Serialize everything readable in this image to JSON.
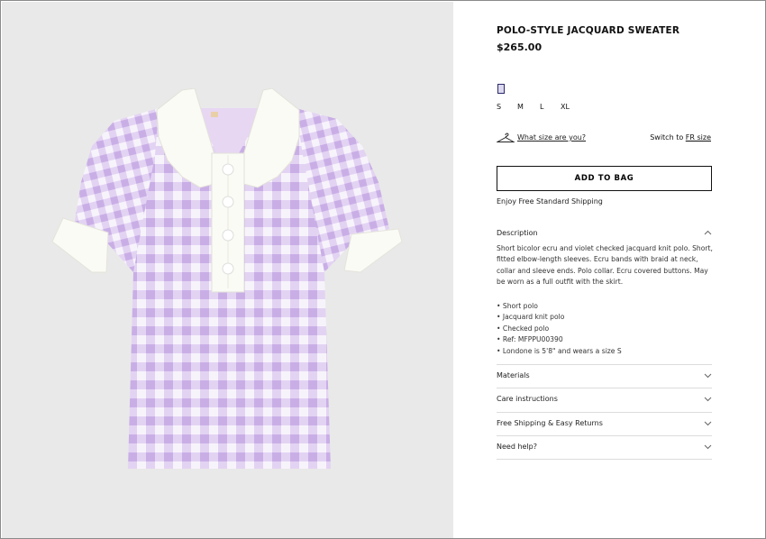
{
  "product": {
    "title": "POLO-STYLE JACQUARD SWEATER",
    "price": "$265.00",
    "sizes": [
      "S",
      "M",
      "L",
      "XL"
    ],
    "size_help": "What size are you?",
    "switch_prefix": "Switch to",
    "switch_link": "FR size",
    "add_to_bag": "ADD TO BAG",
    "shipping_note": "Enjoy Free Standard Shipping"
  },
  "accordion": {
    "description": {
      "label": "Description",
      "text": "Short bicolor ecru and violet checked jacquard knit polo. Short, fitted elbow-length sleeves. Ecru bands with braid at neck, collar and sleeve ends. Polo collar. Ecru covered buttons. May be worn as a full outfit with the skirt.",
      "bullets": [
        "• Short polo",
        "• Jacquard knit polo",
        "• Checked polo",
        "• Ref: MFPPU00390",
        "• Londone is 5'8\" and wears a size S"
      ]
    },
    "materials": "Materials",
    "care": "Care instructions",
    "returns": "Free Shipping & Easy Returns",
    "help": "Need help?"
  },
  "icons": {
    "hanger": "hanger-icon",
    "chevron_up": "chevron-up-icon",
    "chevron_down": "chevron-down-icon"
  },
  "colors": {
    "image_background": "#e9e9e9",
    "gingham_lilac": "#d8c3ee",
    "ecru": "#fbfbf5"
  }
}
